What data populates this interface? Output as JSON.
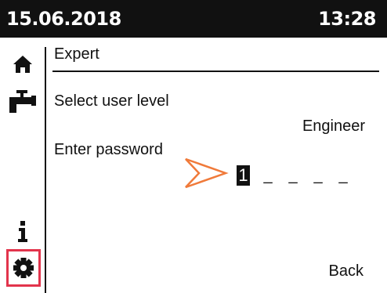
{
  "header": {
    "date": "15.06.2018",
    "time": "13:28"
  },
  "sidebar": {
    "items": [
      {
        "icon": "home-icon"
      },
      {
        "icon": "tap-icon"
      },
      {
        "icon": "info-icon"
      },
      {
        "icon": "settings-icon",
        "selected": true
      }
    ],
    "selected_border_color": "#e2344c"
  },
  "main": {
    "title": "Expert",
    "user_level_label": "Select user level",
    "user_level_value": "Engineer",
    "password_label": "Enter password",
    "password": {
      "active_digit": "1",
      "slots": [
        "_",
        "_",
        "_",
        "_"
      ]
    },
    "pointer_color": "#f07a3a",
    "back_label": "Back"
  }
}
